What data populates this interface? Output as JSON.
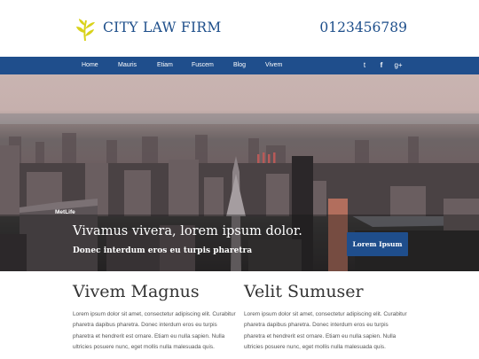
{
  "header": {
    "brand": "CITY LAW FIRM",
    "phone": "0123456789",
    "logo_icon": "leaf-icon"
  },
  "nav": {
    "items": [
      "Home",
      "Mauris",
      "Etiam",
      "Fuscem",
      "Blog",
      "Vivem"
    ],
    "social": [
      {
        "icon": "twitter-icon",
        "glyph": "t"
      },
      {
        "icon": "facebook-icon",
        "glyph": "f"
      },
      {
        "icon": "googleplus-icon",
        "glyph": "g+"
      }
    ]
  },
  "hero": {
    "title": "Vivamus vivera, lorem ipsum dolor.",
    "subtitle": "Donec interdum eros eu turpis pharetra",
    "button": "Lorem Ipsum",
    "sign_text": "MetLife"
  },
  "columns": [
    {
      "heading": "Vivem Magnus",
      "text": "Lorem ipsum dolor sit amet, consectetur adipiscing elit. Curabitur pharetra dapibus pharetra. Donec interdum eros eu turpis pharetra et hendrerit est ornare. Etiam eu nulla sapien. Nulla ultricies posuere nunc, eget mollis nulla malesuada quis."
    },
    {
      "heading": "Velit Sumuser",
      "text": "Lorem ipsum dolor sit amet, consectetur adipiscing elit. Curabitur pharetra dapibus pharetra. Donec interdum eros eu turpis pharetra et hendrerit est ornare. Etiam eu nulla sapien. Nulla ultricies posuere nunc, eget mollis nulla malesuada quis."
    }
  ],
  "colors": {
    "brand": "#1f4e8c",
    "logo": "#d9d21a"
  }
}
